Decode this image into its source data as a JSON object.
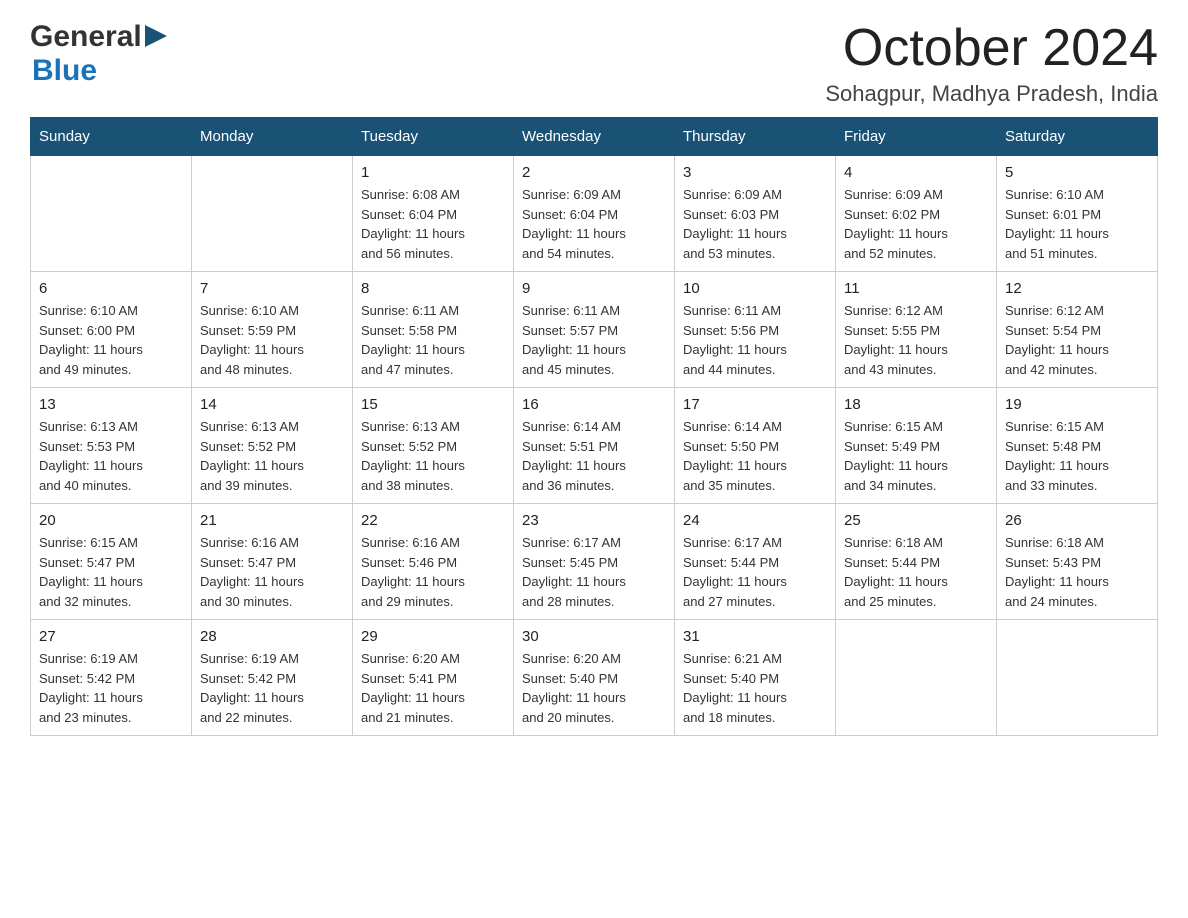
{
  "header": {
    "logo_general": "General",
    "logo_blue": "Blue",
    "month": "October 2024",
    "location": "Sohagpur, Madhya Pradesh, India"
  },
  "days_of_week": [
    "Sunday",
    "Monday",
    "Tuesday",
    "Wednesday",
    "Thursday",
    "Friday",
    "Saturday"
  ],
  "weeks": [
    [
      {
        "day": "",
        "info": ""
      },
      {
        "day": "",
        "info": ""
      },
      {
        "day": "1",
        "info": "Sunrise: 6:08 AM\nSunset: 6:04 PM\nDaylight: 11 hours\nand 56 minutes."
      },
      {
        "day": "2",
        "info": "Sunrise: 6:09 AM\nSunset: 6:04 PM\nDaylight: 11 hours\nand 54 minutes."
      },
      {
        "day": "3",
        "info": "Sunrise: 6:09 AM\nSunset: 6:03 PM\nDaylight: 11 hours\nand 53 minutes."
      },
      {
        "day": "4",
        "info": "Sunrise: 6:09 AM\nSunset: 6:02 PM\nDaylight: 11 hours\nand 52 minutes."
      },
      {
        "day": "5",
        "info": "Sunrise: 6:10 AM\nSunset: 6:01 PM\nDaylight: 11 hours\nand 51 minutes."
      }
    ],
    [
      {
        "day": "6",
        "info": "Sunrise: 6:10 AM\nSunset: 6:00 PM\nDaylight: 11 hours\nand 49 minutes."
      },
      {
        "day": "7",
        "info": "Sunrise: 6:10 AM\nSunset: 5:59 PM\nDaylight: 11 hours\nand 48 minutes."
      },
      {
        "day": "8",
        "info": "Sunrise: 6:11 AM\nSunset: 5:58 PM\nDaylight: 11 hours\nand 47 minutes."
      },
      {
        "day": "9",
        "info": "Sunrise: 6:11 AM\nSunset: 5:57 PM\nDaylight: 11 hours\nand 45 minutes."
      },
      {
        "day": "10",
        "info": "Sunrise: 6:11 AM\nSunset: 5:56 PM\nDaylight: 11 hours\nand 44 minutes."
      },
      {
        "day": "11",
        "info": "Sunrise: 6:12 AM\nSunset: 5:55 PM\nDaylight: 11 hours\nand 43 minutes."
      },
      {
        "day": "12",
        "info": "Sunrise: 6:12 AM\nSunset: 5:54 PM\nDaylight: 11 hours\nand 42 minutes."
      }
    ],
    [
      {
        "day": "13",
        "info": "Sunrise: 6:13 AM\nSunset: 5:53 PM\nDaylight: 11 hours\nand 40 minutes."
      },
      {
        "day": "14",
        "info": "Sunrise: 6:13 AM\nSunset: 5:52 PM\nDaylight: 11 hours\nand 39 minutes."
      },
      {
        "day": "15",
        "info": "Sunrise: 6:13 AM\nSunset: 5:52 PM\nDaylight: 11 hours\nand 38 minutes."
      },
      {
        "day": "16",
        "info": "Sunrise: 6:14 AM\nSunset: 5:51 PM\nDaylight: 11 hours\nand 36 minutes."
      },
      {
        "day": "17",
        "info": "Sunrise: 6:14 AM\nSunset: 5:50 PM\nDaylight: 11 hours\nand 35 minutes."
      },
      {
        "day": "18",
        "info": "Sunrise: 6:15 AM\nSunset: 5:49 PM\nDaylight: 11 hours\nand 34 minutes."
      },
      {
        "day": "19",
        "info": "Sunrise: 6:15 AM\nSunset: 5:48 PM\nDaylight: 11 hours\nand 33 minutes."
      }
    ],
    [
      {
        "day": "20",
        "info": "Sunrise: 6:15 AM\nSunset: 5:47 PM\nDaylight: 11 hours\nand 32 minutes."
      },
      {
        "day": "21",
        "info": "Sunrise: 6:16 AM\nSunset: 5:47 PM\nDaylight: 11 hours\nand 30 minutes."
      },
      {
        "day": "22",
        "info": "Sunrise: 6:16 AM\nSunset: 5:46 PM\nDaylight: 11 hours\nand 29 minutes."
      },
      {
        "day": "23",
        "info": "Sunrise: 6:17 AM\nSunset: 5:45 PM\nDaylight: 11 hours\nand 28 minutes."
      },
      {
        "day": "24",
        "info": "Sunrise: 6:17 AM\nSunset: 5:44 PM\nDaylight: 11 hours\nand 27 minutes."
      },
      {
        "day": "25",
        "info": "Sunrise: 6:18 AM\nSunset: 5:44 PM\nDaylight: 11 hours\nand 25 minutes."
      },
      {
        "day": "26",
        "info": "Sunrise: 6:18 AM\nSunset: 5:43 PM\nDaylight: 11 hours\nand 24 minutes."
      }
    ],
    [
      {
        "day": "27",
        "info": "Sunrise: 6:19 AM\nSunset: 5:42 PM\nDaylight: 11 hours\nand 23 minutes."
      },
      {
        "day": "28",
        "info": "Sunrise: 6:19 AM\nSunset: 5:42 PM\nDaylight: 11 hours\nand 22 minutes."
      },
      {
        "day": "29",
        "info": "Sunrise: 6:20 AM\nSunset: 5:41 PM\nDaylight: 11 hours\nand 21 minutes."
      },
      {
        "day": "30",
        "info": "Sunrise: 6:20 AM\nSunset: 5:40 PM\nDaylight: 11 hours\nand 20 minutes."
      },
      {
        "day": "31",
        "info": "Sunrise: 6:21 AM\nSunset: 5:40 PM\nDaylight: 11 hours\nand 18 minutes."
      },
      {
        "day": "",
        "info": ""
      },
      {
        "day": "",
        "info": ""
      }
    ]
  ]
}
